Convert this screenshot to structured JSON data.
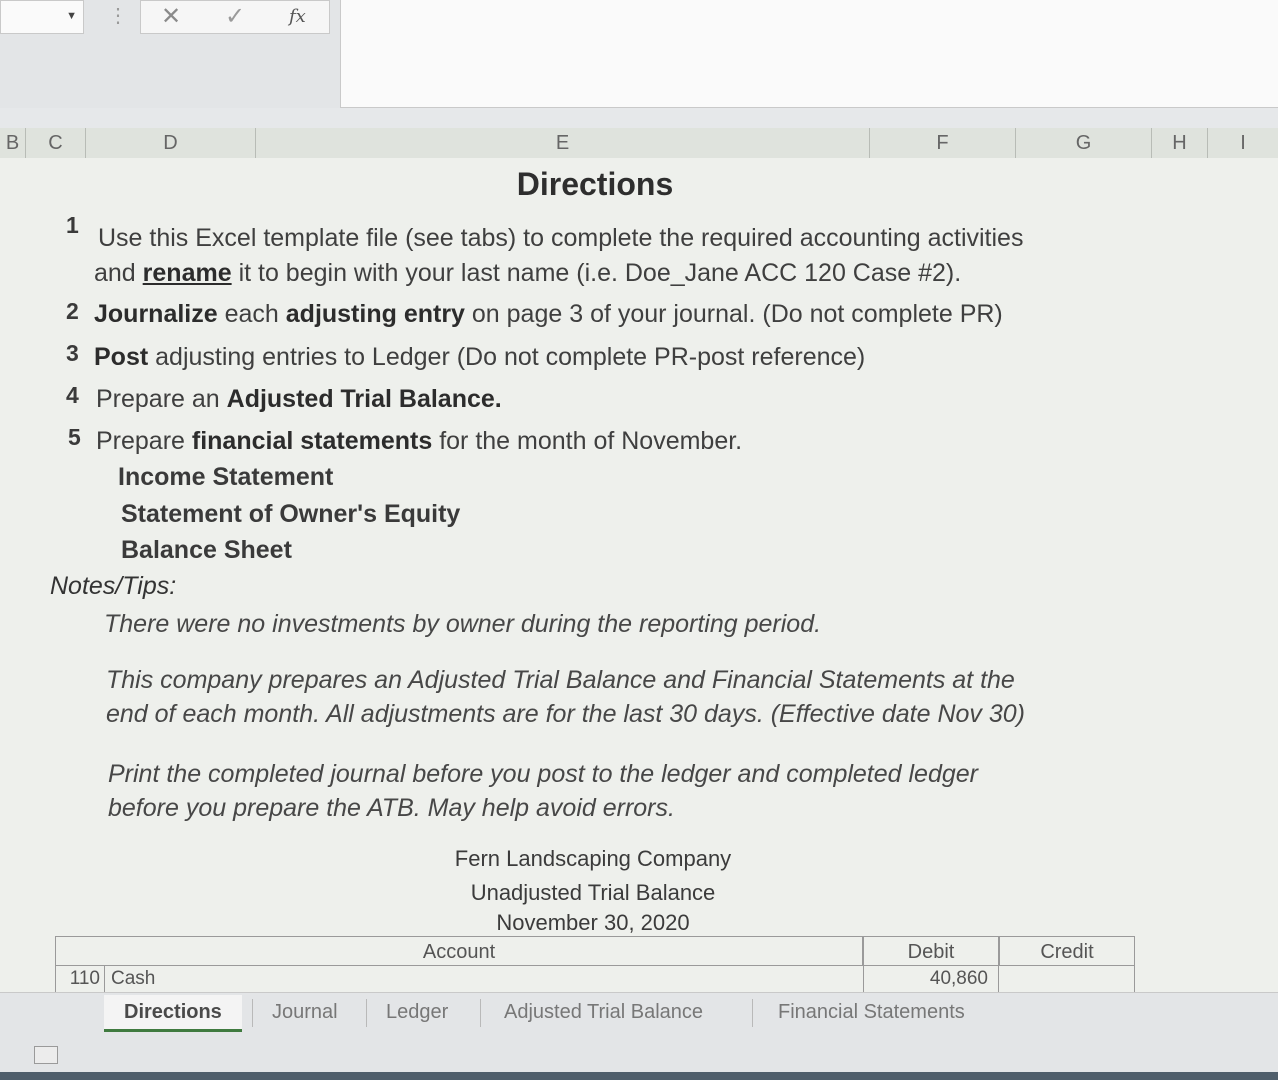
{
  "formula_bar": {
    "cancel_icon": "x-icon",
    "enter_icon": "check-icon",
    "fx_label": "fx",
    "content": ""
  },
  "columns": [
    "B",
    "C",
    "D",
    "E",
    "F",
    "G",
    "H",
    "I"
  ],
  "directions": {
    "title": "Directions",
    "steps": [
      {
        "num": "1",
        "parts": [
          "Use this Excel template file (see tabs) to complete the required accounting activities"
        ],
        "cont_before": "and ",
        "cont_bold": "rename",
        "cont_after": " it to begin with your last name (i.e. Doe_Jane ACC 120 Case #2)."
      },
      {
        "num": "2",
        "b1": "Journalize",
        "t1": " each ",
        "b2": "adjusting entry",
        "t2": " on page 3 of your journal. (Do not complete PR)"
      },
      {
        "num": "3",
        "b1": "Post",
        "t1": " adjusting entries to Ledger (Do not complete PR-post reference)"
      },
      {
        "num": "4",
        "t0": "Prepare an ",
        "b1": "Adjusted Trial Balance."
      },
      {
        "num": "5",
        "t0": "Prepare ",
        "b1": "financial statements",
        "t1": " for the month of November."
      }
    ],
    "statements": [
      "Income Statement",
      "Statement of Owner's Equity",
      "Balance Sheet"
    ],
    "notes_header": "Notes/Tips:",
    "notes": [
      "There were no investments by owner during the reporting period.",
      "This company prepares an Adjusted Trial Balance and Financial Statements at the",
      "end of each month.   All adjustments are for the last 30 days. (Effective date Nov 30)",
      "Print the completed journal before you post to the ledger and completed ledger",
      "before you prepare the ATB.  May help avoid errors."
    ]
  },
  "trial_balance": {
    "company": "Fern Landscaping Company",
    "report": "Unadjusted Trial Balance",
    "date": "November 30, 2020",
    "headers": {
      "account": "Account",
      "debit": "Debit",
      "credit": "Credit"
    },
    "rows": [
      {
        "no": "110",
        "account": "Cash",
        "debit": "40,860",
        "credit": ""
      }
    ]
  },
  "tabs": [
    "Directions",
    "Journal",
    "Ledger",
    "Adjusted Trial Balance",
    "Financial Statements"
  ],
  "active_tab": "Directions"
}
